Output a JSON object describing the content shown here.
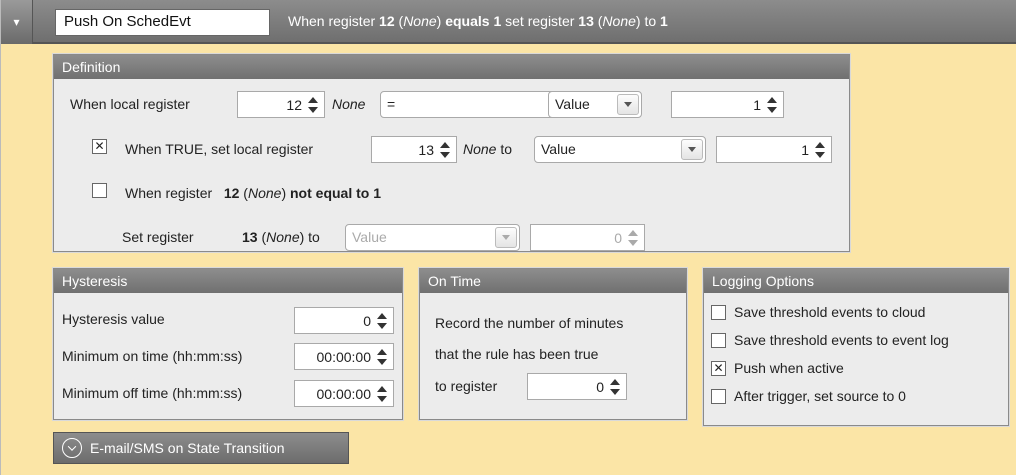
{
  "header": {
    "collapse_glyph": "▾",
    "rule_name": "Push On SchedEvt",
    "summary_prefix": "When register ",
    "summary_reg": "12",
    "summary_reg_name": "None",
    "summary_equals": "equals 1",
    "summary_set": " set register ",
    "summary_target": "13",
    "summary_target_name": "None",
    "summary_to": " to ",
    "summary_value": "1"
  },
  "definition": {
    "title": "Definition",
    "when_local_label": "When local register",
    "local_register": "12",
    "local_register_name": "None",
    "operator": "=",
    "compare_type": "Value",
    "compare_value": "1",
    "when_true_checked": "✕",
    "when_true_label": "When TRUE, set local register",
    "true_register": "13",
    "true_register_name": "None",
    "to_label": "to",
    "true_type": "Value",
    "true_value": "1",
    "when_register_checked": "",
    "when_register_label": "When register",
    "false_reg": "12",
    "false_reg_name": "None",
    "not_equal_text": "not equal to 1",
    "set_register_label": "Set register",
    "set_reg": "13",
    "set_reg_name": "None",
    "set_to_label": "to",
    "set_type": "Value",
    "set_value": "0"
  },
  "hysteresis": {
    "title": "Hysteresis",
    "value_label": "Hysteresis value",
    "value": "0",
    "min_on_label": "Minimum on time (hh:mm:ss)",
    "min_on": "00:00:00",
    "min_off_label": "Minimum off time (hh:mm:ss)",
    "min_off": "00:00:00"
  },
  "on_time": {
    "title": "On Time",
    "line1": "Record the number of minutes",
    "line2": "that the rule has been true",
    "line3": "to register",
    "register": "0"
  },
  "logging": {
    "title": "Logging Options",
    "options": [
      {
        "label": "Save threshold events to cloud",
        "checked": ""
      },
      {
        "label": "Save threshold events to event log",
        "checked": ""
      },
      {
        "label": "Push when active",
        "checked": "✕"
      },
      {
        "label": "After trigger, set source to 0",
        "checked": ""
      }
    ]
  },
  "email": {
    "label": "E-mail/SMS on State Transition"
  }
}
